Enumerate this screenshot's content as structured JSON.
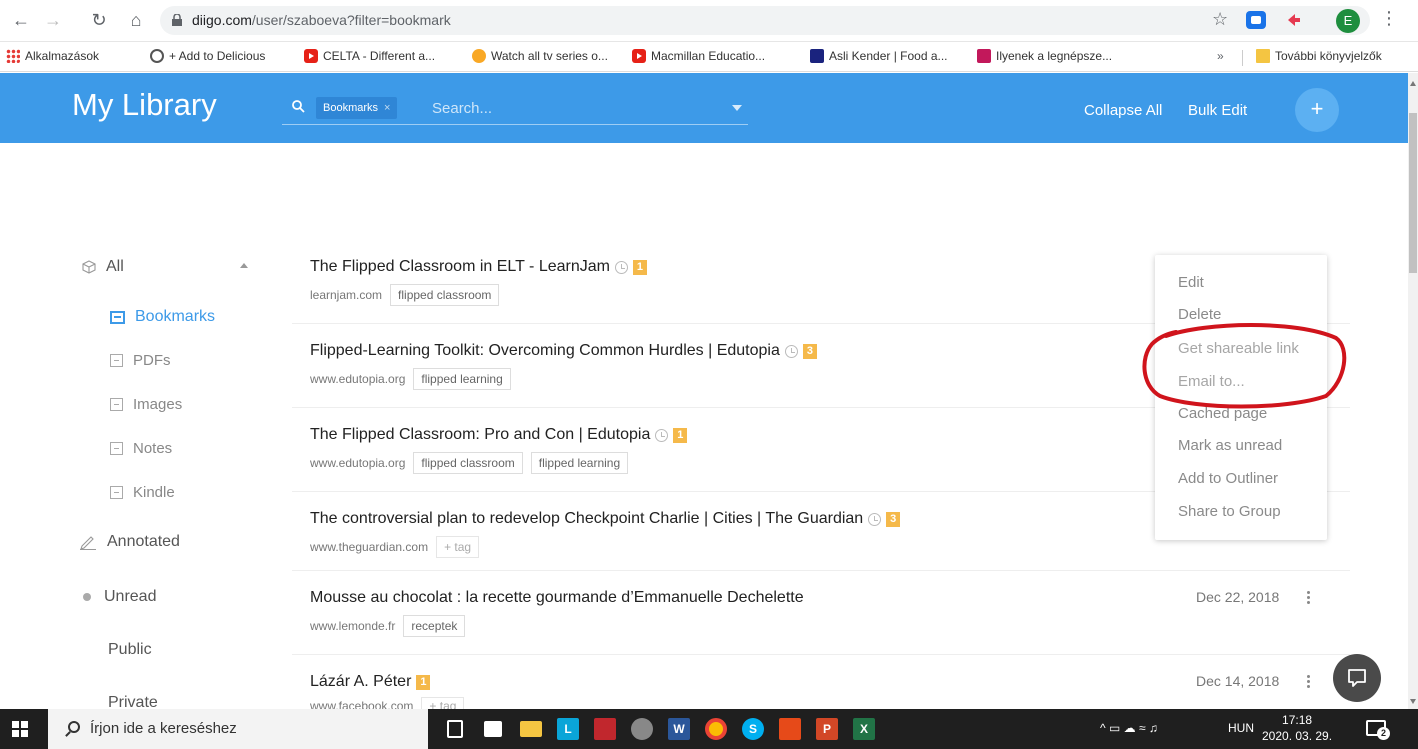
{
  "browser": {
    "url_host": "diigo.com",
    "url_path": "/user/szaboeva?filter=bookmark",
    "profile_initial": "E",
    "bookmarks_bar": [
      "Alkalmazások",
      "+ Add to Delicious",
      "CELTA - Different a...",
      "Watch all tv series o...",
      "Macmillan Educatio...",
      "Asli Kender | Food a...",
      "Ilyenek a legnépsze..."
    ],
    "more_label": "»",
    "other_bookmarks": "További könyvjelzők"
  },
  "header": {
    "title": "My Library",
    "filter_chip": "Bookmarks",
    "filter_chip_close": "×",
    "search_placeholder": "Search...",
    "collapse_all": "Collapse All",
    "bulk_edit": "Bulk Edit",
    "add_label": "+"
  },
  "sidebar": {
    "all": "All",
    "sub_items": [
      "Bookmarks",
      "PDFs",
      "Images",
      "Notes",
      "Kindle"
    ],
    "annotated": "Annotated",
    "unread": "Unread",
    "public": "Public",
    "private": "Private"
  },
  "bookmarks": [
    {
      "title": "The Flipped Classroom in ELT - LearnJam",
      "badge": "1",
      "domain": "learnjam.com",
      "tags": [
        "flipped classroom"
      ],
      "date": ""
    },
    {
      "title": "Flipped-Learning Toolkit: Overcoming Common Hurdles | Edutopia",
      "badge": "3",
      "domain": "www.edutopia.org",
      "tags": [
        "flipped learning"
      ],
      "date": ""
    },
    {
      "title": "The Flipped Classroom: Pro and Con | Edutopia",
      "badge": "1",
      "domain": "www.edutopia.org",
      "tags": [
        "flipped classroom",
        "flipped learning"
      ],
      "date": ""
    },
    {
      "title": "The controversial plan to redevelop Checkpoint Charlie | Cities | The Guardian",
      "badge": "3",
      "domain": "www.theguardian.com",
      "tags": [
        "+ tag"
      ],
      "date": ""
    },
    {
      "title": "Mousse au chocolat : la recette gourmande d’Emmanuelle Dechelette",
      "badge": "",
      "domain": "www.lemonde.fr",
      "tags": [
        "receptek"
      ],
      "date": "Dec 22, 2018"
    },
    {
      "title": "Lázár A. Péter",
      "badge": "1",
      "domain": "www.facebook.com",
      "tags": [
        "+ tag"
      ],
      "date": "Dec 14, 2018"
    }
  ],
  "context_menu": [
    "Edit",
    "Delete",
    "Get shareable link",
    "Email to...",
    "Cached page",
    "Mark as unread",
    "Add to Outliner",
    "Share to Group"
  ],
  "taskbar": {
    "search_placeholder": "Írjon ide a kereséshez",
    "language": "HUN",
    "time": "17:18",
    "date": "2020. 03. 29.",
    "notifications": "2"
  },
  "colors": {
    "brand": "#3d9ae8",
    "badge": "#f5b94a",
    "annotation": "#d0141c"
  }
}
